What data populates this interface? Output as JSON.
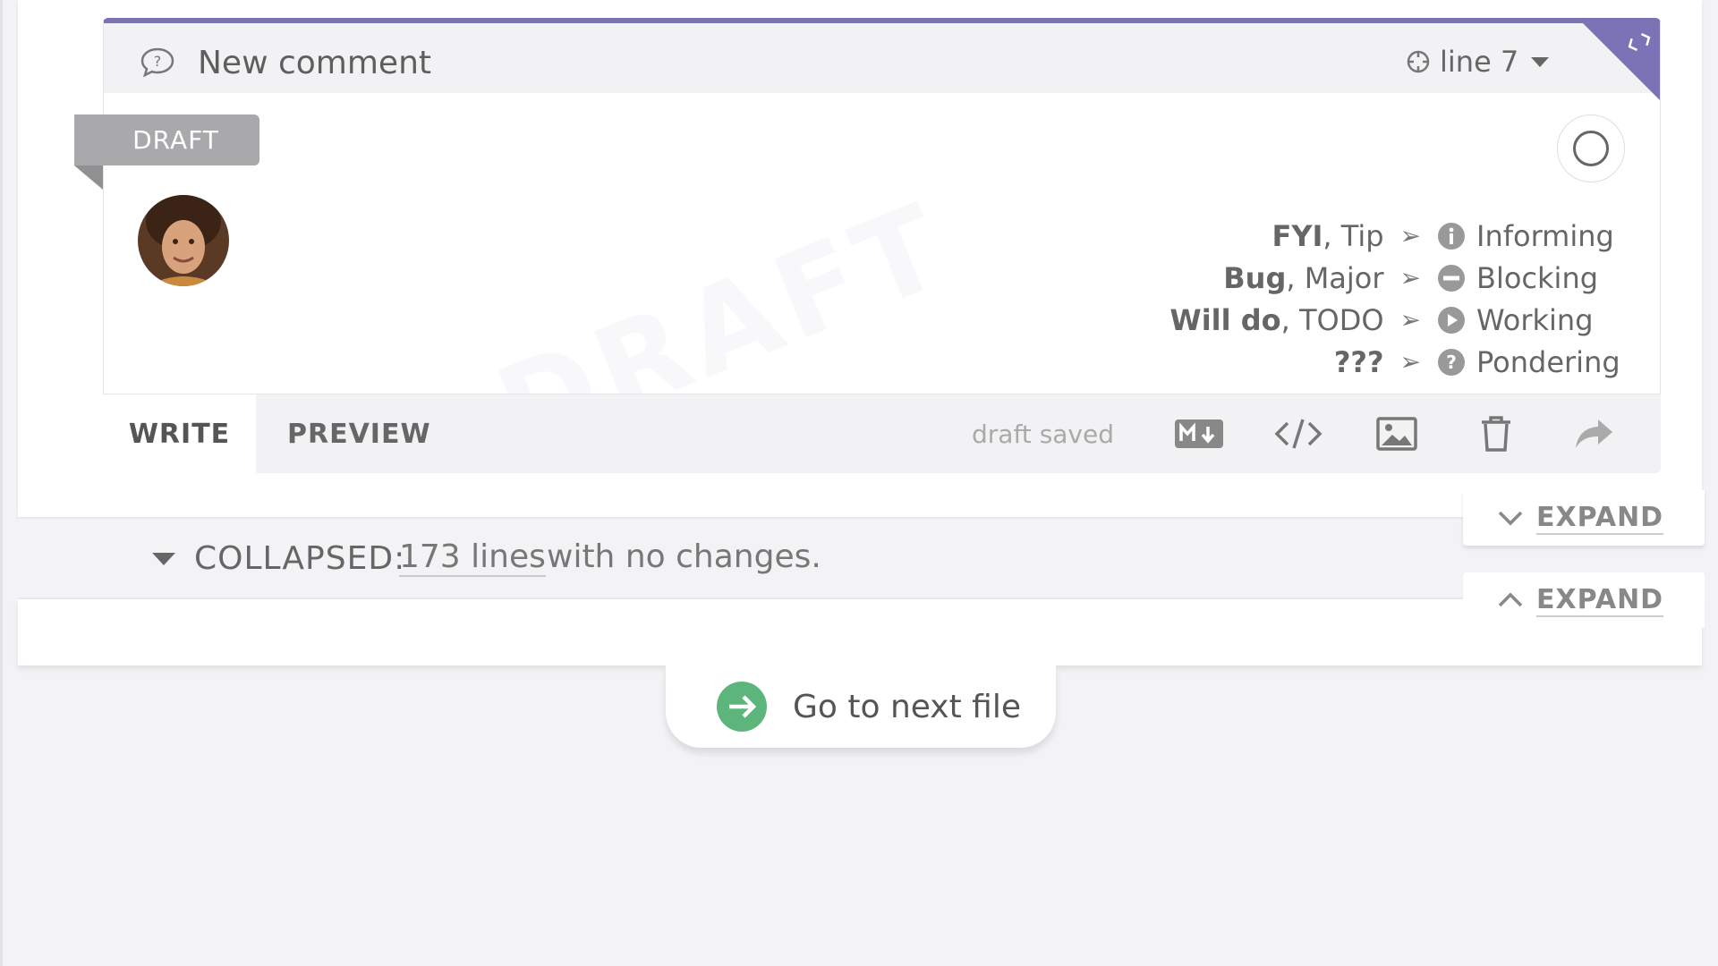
{
  "comment": {
    "title": "New comment",
    "line_ref": "line 7",
    "draft_badge": "DRAFT",
    "watermark": "DRAFT",
    "accent": "#7a73b5"
  },
  "legend": [
    {
      "keyword": "FYI",
      "rest": ", Tip",
      "status": "Informing",
      "icon": "info-icon"
    },
    {
      "keyword": "Bug",
      "rest": ", Major",
      "status": "Blocking",
      "icon": "blocking-icon"
    },
    {
      "keyword": "Will do",
      "rest": ", TODO",
      "status": "Working",
      "icon": "play-icon"
    },
    {
      "keyword": "???",
      "rest": "",
      "status": "Pondering",
      "icon": "question-icon"
    }
  ],
  "legend_separator": "➢",
  "toolbar": {
    "write_tab": "WRITE",
    "preview_tab": "PREVIEW",
    "status": "draft saved"
  },
  "expand": {
    "down_label": "EXPAND",
    "up_label": "EXPAND"
  },
  "collapsed": {
    "label": "COLLAPSED:",
    "link": "173 lines",
    "rest": "with no changes."
  },
  "next_file": {
    "label": "Go to next file",
    "icon_color": "#5cb57a"
  }
}
